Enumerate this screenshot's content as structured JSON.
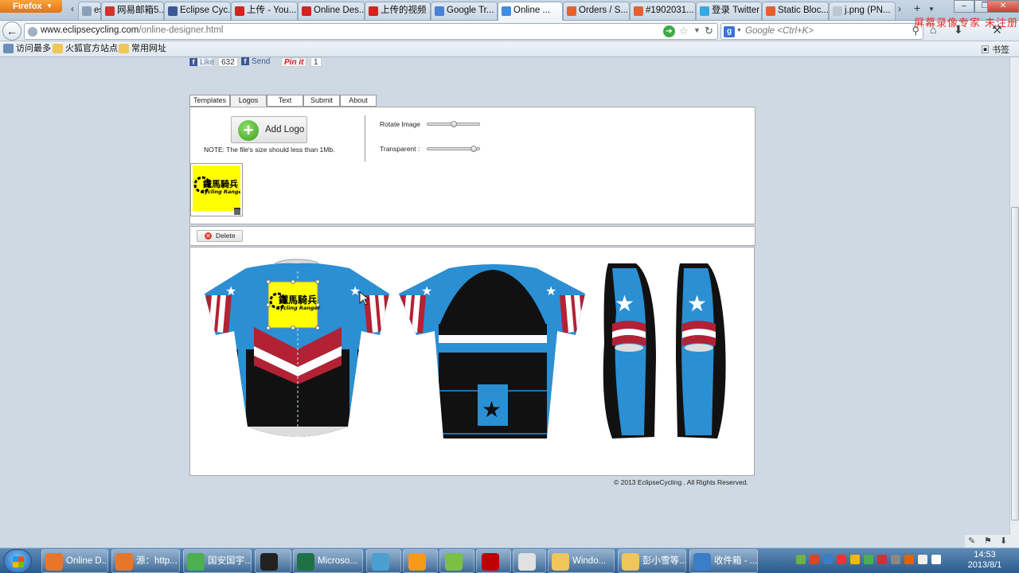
{
  "browser": {
    "menu_label": "Firefox",
    "tabs": [
      {
        "label": "es...",
        "icon": "page-icon",
        "color": "#8aa0b8"
      },
      {
        "label": "网易邮箱5....",
        "icon": "netease-mail-icon",
        "color": "#d9302c"
      },
      {
        "label": "Eclipse Cyc...",
        "icon": "facebook-icon",
        "color": "#3b5998"
      },
      {
        "label": "上传 - You...",
        "icon": "youtube-icon",
        "color": "#d8201f"
      },
      {
        "label": "Online Des...",
        "icon": "youtube-icon",
        "color": "#d8201f"
      },
      {
        "label": "上传的视频 ...",
        "icon": "youtube-icon",
        "color": "#d8201f"
      },
      {
        "label": "Google Tr...",
        "icon": "google-translate-icon",
        "color": "#4a7fd6"
      },
      {
        "label": "Online ...",
        "icon": "eclipse-site-icon",
        "color": "#3d8de0",
        "active": true
      },
      {
        "label": "Orders / S...",
        "icon": "magento-icon",
        "color": "#e5602d"
      },
      {
        "label": "#1902031...",
        "icon": "magento-icon",
        "color": "#e5602d"
      },
      {
        "label": "登录 Twitter",
        "icon": "twitter-icon",
        "color": "#35a9e0"
      },
      {
        "label": "Static Bloc...",
        "icon": "magento-icon",
        "color": "#e5602d"
      },
      {
        "label": "j.png (PN...",
        "icon": "image-file-icon",
        "color": "#bcc6d0"
      }
    ],
    "url_host": "www.eclipsecycling.com",
    "url_path": "/online-designer.html",
    "url_prefix": "",
    "search_placeholder": "Google <Ctrl+K>",
    "search_engine": "g",
    "watermark": "屏幕录像专家  未注册",
    "bookmarks": [
      {
        "label": "访问最多",
        "icon": "bookmark-gear-icon",
        "color": "#6b8fb8"
      },
      {
        "label": "火狐官方站点",
        "icon": "folder-icon",
        "color": "#f0c65a"
      },
      {
        "label": "常用网址",
        "icon": "folder-icon",
        "color": "#f0c65a"
      }
    ],
    "bookmarks_menu": "书签"
  },
  "social": {
    "like_label": "Like",
    "like_count": "632",
    "send_label": "Send",
    "pin_label": "Pin it",
    "pin_count": "1"
  },
  "designer": {
    "tabs": [
      "Templates",
      "Logos",
      "Text",
      "Submit",
      "About"
    ],
    "active_tab": "Logos",
    "add_logo_label": "Add Logo",
    "note": "NOTE: The file's size should less than 1Mb.",
    "rotate_label": "Rotate Image",
    "rotate_value": 0.5,
    "transparent_label": "Transparent :",
    "transparent_value": 0.95,
    "logo_text_cn": "鐵馬騎兵",
    "logo_text_en": "Cycling Ranger",
    "delete_label": "Delete",
    "copyright": "© 2013 EclipseCycling . All Rights Reserved."
  },
  "colors": {
    "jersey_blue": "#2b8fd3",
    "jersey_black": "#111111",
    "jersey_red": "#b22234",
    "logo_yellow": "#ffff00"
  },
  "taskbar": {
    "items": [
      {
        "label": "Online D...",
        "icon": "firefox-icon",
        "color": "#e8762a"
      },
      {
        "label": "源：http...",
        "icon": "firefox-icon",
        "color": "#e8762a"
      },
      {
        "label": "国安国宇...",
        "icon": "chrome-icon",
        "color": "#4caf50"
      },
      {
        "label": "",
        "icon": "qq-penguin-icon",
        "color": "#222"
      },
      {
        "label": "Microso...",
        "icon": "excel-icon",
        "color": "#1e7145"
      },
      {
        "label": "",
        "icon": "app-icon",
        "color": "#4a9fd0"
      },
      {
        "label": "",
        "icon": "illustrator-icon",
        "color": "#f79a1b"
      },
      {
        "label": "",
        "icon": "evernote-icon",
        "color": "#7ac143"
      },
      {
        "label": "",
        "icon": "filezilla-icon",
        "color": "#bf0000"
      },
      {
        "label": "",
        "icon": "pen-icon",
        "color": "#e1e1e1"
      },
      {
        "label": "Windo...",
        "icon": "folder-icon",
        "color": "#f0c65a"
      },
      {
        "label": "彭小雪等...",
        "icon": "folder-icon",
        "color": "#f0c65a"
      },
      {
        "label": "收件箱 - ...",
        "icon": "mail-icon",
        "color": "#3a7dc8"
      }
    ],
    "time": "14:53",
    "date": "2013/8/1"
  }
}
